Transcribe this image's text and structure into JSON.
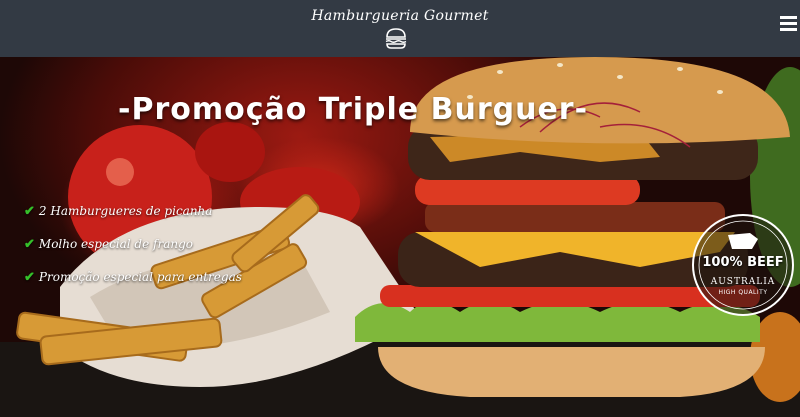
{
  "header": {
    "brand": "Hamburgueria Gourmet",
    "brand_icon": "burger-icon",
    "menu_icon": "hamburger-menu-icon",
    "background_color": "#333a44"
  },
  "hero": {
    "title": "-Promoção Triple Burguer-",
    "features": [
      "2 Hamburgueres de picanha",
      "Molho especial de frango",
      "Promoção especial para entregas"
    ],
    "check_color": "#35c02a",
    "badge": {
      "line1": "100% BEEF",
      "line2": "AUSTRALIA",
      "line3": "HIGH QUALITY"
    }
  }
}
